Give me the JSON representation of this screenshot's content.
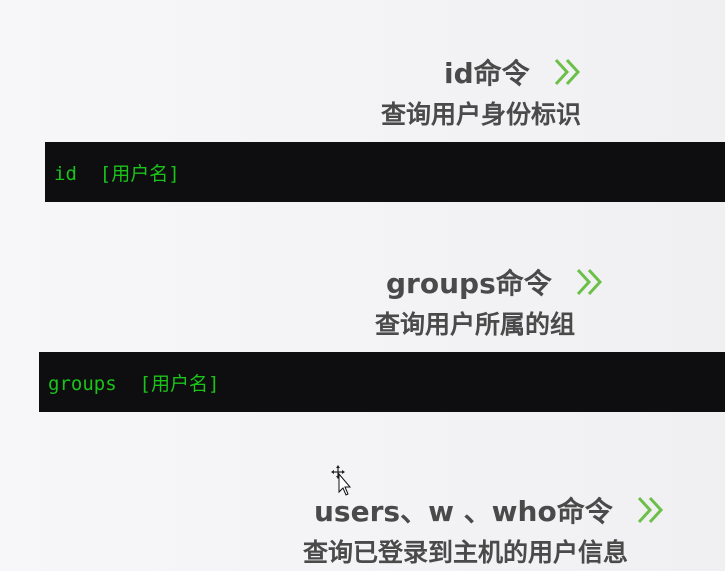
{
  "sections": [
    {
      "heading": "id命令",
      "subtitle": "查询用户身份标识",
      "command": "id  [用户名]"
    },
    {
      "heading": "groups命令",
      "subtitle": "查询用户所属的组",
      "command": "groups  [用户名]"
    },
    {
      "heading": "users、w 、who命令",
      "subtitle": "查询已登录到主机的用户信息"
    }
  ],
  "colors": {
    "accent": "#6cc04a",
    "heading": "#4a4a4a",
    "terminal_bg": "#0e0d0f",
    "terminal_text": "#19c319"
  }
}
